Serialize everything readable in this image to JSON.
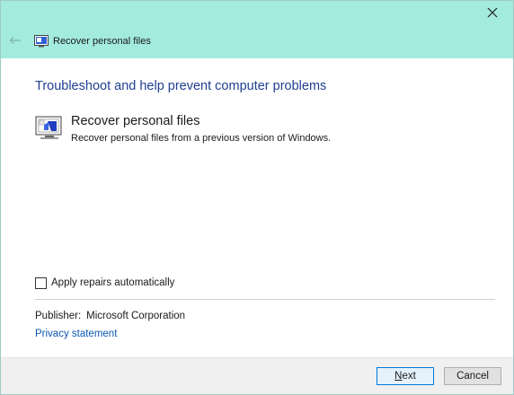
{
  "window": {
    "title": "Recover personal files",
    "close_glyph": "✕",
    "back_glyph": "←"
  },
  "main": {
    "heading": "Troubleshoot and help prevent computer problems",
    "troubleshooter": {
      "title": "Recover personal files",
      "description": "Recover personal files from a previous version of Windows.",
      "icon": "recovery-computer-icon"
    },
    "apply_repairs": {
      "label": "Apply repairs automatically",
      "checked": false
    },
    "publisher_label": "Publisher:",
    "publisher_value": "Microsoft Corporation",
    "privacy_link": "Privacy statement"
  },
  "footer": {
    "next_mnemonic": "N",
    "next_rest": "ext",
    "cancel_label": "Cancel"
  },
  "colors": {
    "titlebar": "#a3eadf",
    "heading": "#1f3f8f",
    "link": "#0b57b0",
    "footer": "#f0f0f0"
  }
}
